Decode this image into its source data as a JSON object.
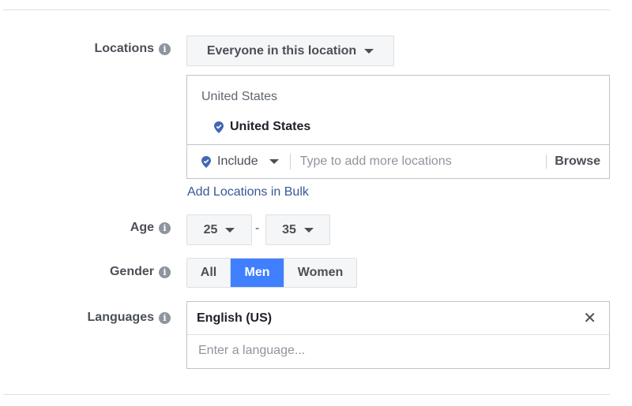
{
  "locations": {
    "label": "Locations",
    "info_icon": "i",
    "dropdown_label": "Everyone in this location",
    "header": "United States",
    "selected_items": [
      "United States"
    ],
    "include_label": "Include",
    "placeholder": "Type to add more locations",
    "browse_label": "Browse",
    "bulk_link": "Add Locations in Bulk",
    "pin_color": "#4267b2"
  },
  "age": {
    "label": "Age",
    "info_icon": "i",
    "min": "25",
    "separator": "-",
    "max": "35"
  },
  "gender": {
    "label": "Gender",
    "info_icon": "i",
    "options": [
      "All",
      "Men",
      "Women"
    ],
    "selected": "Men",
    "active_color": "#4080ff"
  },
  "languages": {
    "label": "Languages",
    "info_icon": "i",
    "selected": [
      "English (US)"
    ],
    "remove_glyph": "✕",
    "placeholder": "Enter a language..."
  }
}
